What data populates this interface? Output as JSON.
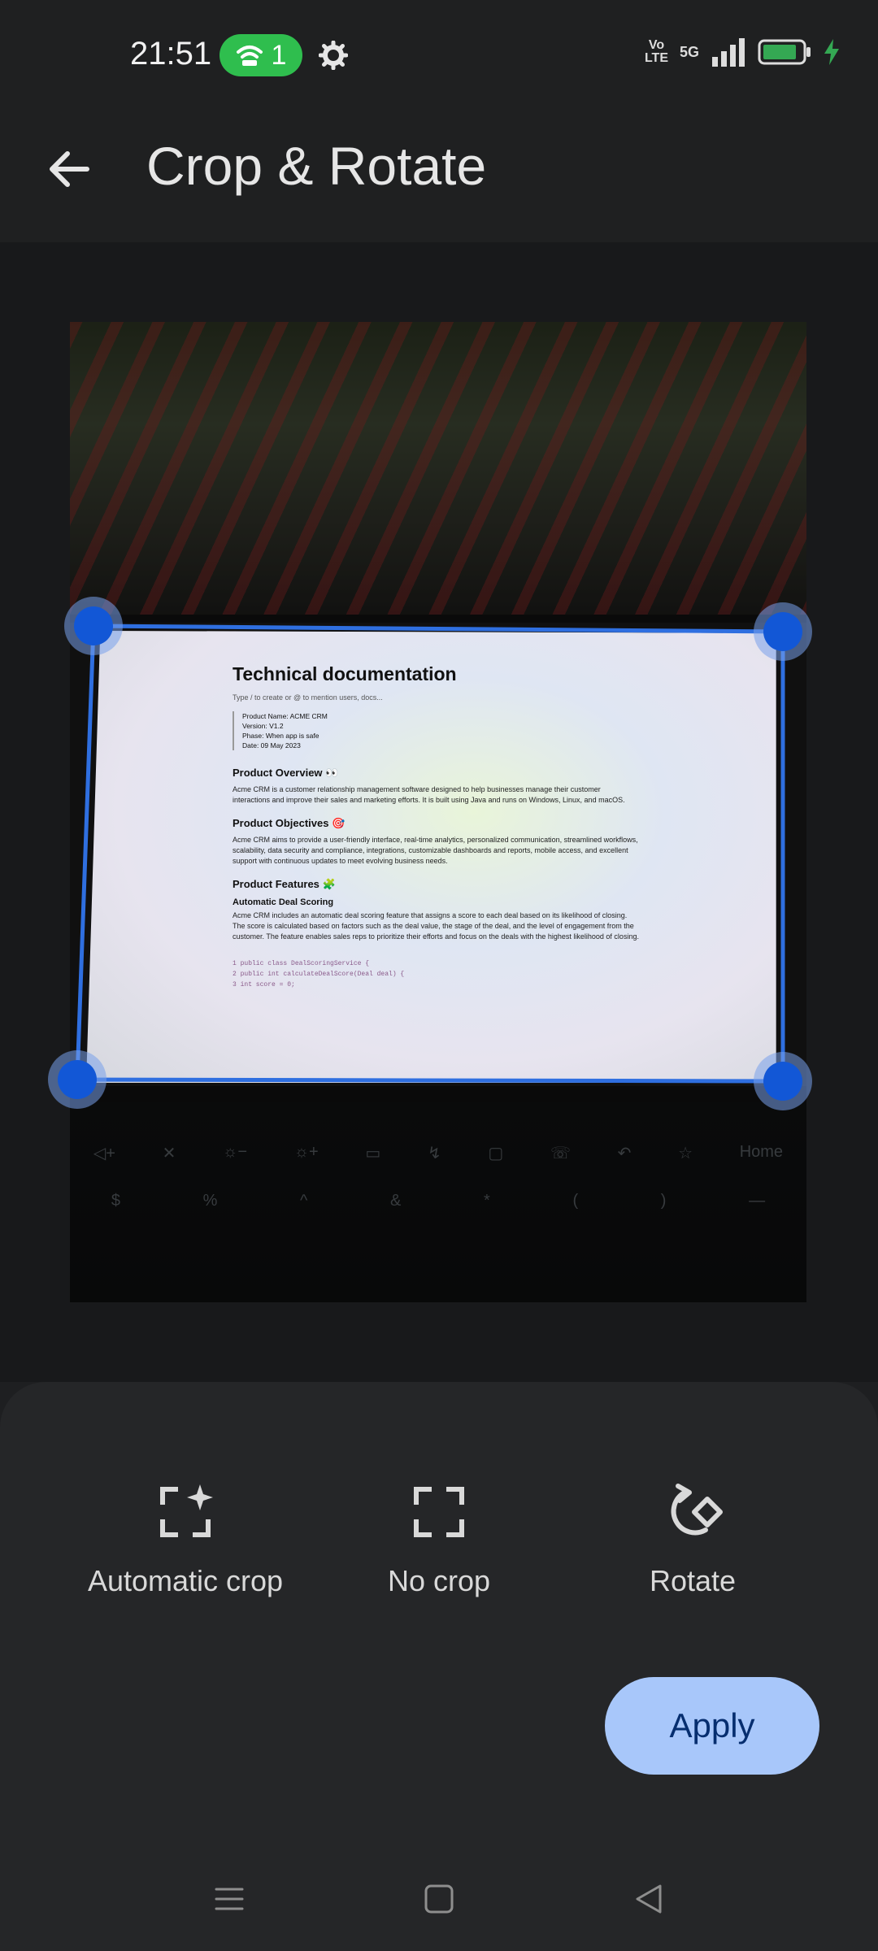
{
  "status_bar": {
    "time": "21:51",
    "hotspot_count": "1",
    "volte_label_top": "Vo",
    "volte_label_bottom": "LTE",
    "network": "5G",
    "battery_color": "#34a853",
    "accent_green": "#2fbe4e"
  },
  "app_bar": {
    "back_icon": "arrow-back-icon",
    "title": "Crop & Rotate"
  },
  "document_preview": {
    "heading": "Technical documentation",
    "hint": "Type / to create or @ to mention users, docs...",
    "meta": [
      "Product Name: ACME CRM",
      "Version: V1.2",
      "Phase: When app is safe",
      "Date: 09 May 2023"
    ],
    "section1_title": "Product Overview 👀",
    "section1_text": "Acme CRM is a customer relationship management software designed to help businesses manage their customer interactions and improve their sales and marketing efforts. It is built using Java and runs on Windows, Linux, and macOS.",
    "section2_title": "Product Objectives 🎯",
    "section2_text": "Acme CRM aims to provide a user-friendly interface, real-time analytics, personalized communication, streamlined workflows, scalability, data security and compliance, integrations, customizable dashboards and reports, mobile access, and excellent support with continuous updates to meet evolving business needs.",
    "section3_title": "Product Features 🧩",
    "subsection_title": "Automatic Deal Scoring",
    "subsection_text": "Acme CRM includes an automatic deal scoring feature that assigns a score to each deal based on its likelihood of closing. The score is calculated based on factors such as the deal value, the stage of the deal, and the level of engagement from the customer. The feature enables sales reps to prioritize their efforts and focus on the deals with the highest likelihood of closing.",
    "code_lines": [
      "1   public class DealScoringService {",
      "2      public int calculateDealScore(Deal deal) {",
      "3         int score = 0;"
    ]
  },
  "keyboard_keys": [
    "Home",
    "$",
    "%",
    "^",
    "&",
    "*",
    "(",
    ")"
  ],
  "options": [
    {
      "label": "Automatic crop",
      "icon": "auto-crop-icon"
    },
    {
      "label": "No crop",
      "icon": "no-crop-icon"
    },
    {
      "label": "Rotate",
      "icon": "rotate-icon"
    }
  ],
  "apply_label": "Apply",
  "nav": {
    "recents_icon": "menu-icon",
    "home_icon": "home-square-icon",
    "back_icon": "back-triangle-icon"
  }
}
